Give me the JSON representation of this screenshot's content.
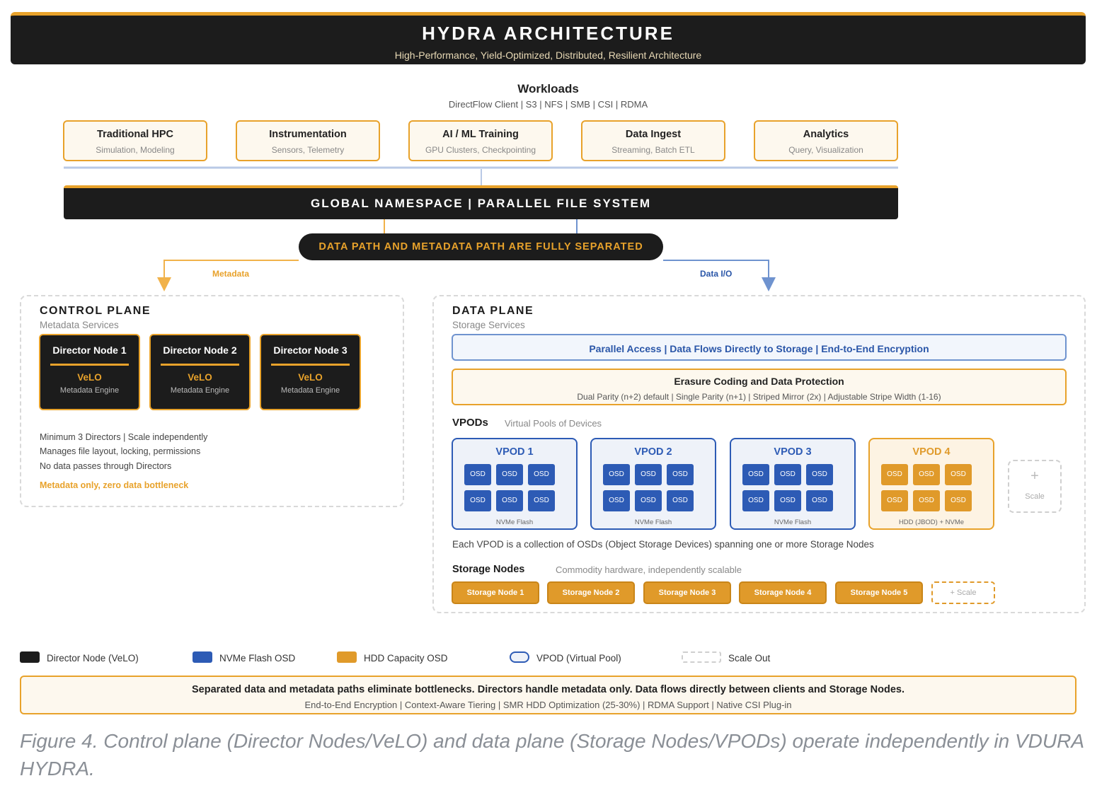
{
  "banner": {
    "title": "HYDRA ARCHITECTURE",
    "subtitle": "High-Performance, Yield-Optimized, Distributed, Resilient Architecture"
  },
  "workloads": {
    "title": "Workloads",
    "protocols": "DirectFlow Client | S3 | NFS | SMB | CSI | RDMA",
    "items": [
      {
        "name": "Traditional HPC",
        "desc": "Simulation, Modeling"
      },
      {
        "name": "Instrumentation",
        "desc": "Sensors, Telemetry"
      },
      {
        "name": "AI / ML Training",
        "desc": "GPU Clusters, Checkpointing"
      },
      {
        "name": "Data Ingest",
        "desc": "Streaming, Batch ETL"
      },
      {
        "name": "Analytics",
        "desc": "Query, Visualization"
      }
    ]
  },
  "global_namespace": "GLOBAL NAMESPACE | PARALLEL FILE SYSTEM",
  "separation_banner": "DATA PATH AND METADATA PATH ARE FULLY SEPARATED",
  "paths": {
    "metadata_label": "Metadata",
    "data_label": "Data I/O"
  },
  "control_plane": {
    "title": "CONTROL PLANE",
    "subtitle": "Metadata Services",
    "directors": [
      {
        "name": "Director Node 1",
        "engine_name": "VeLO",
        "engine_desc": "Metadata Engine"
      },
      {
        "name": "Director Node 2",
        "engine_name": "VeLO",
        "engine_desc": "Metadata Engine"
      },
      {
        "name": "Director Node 3",
        "engine_name": "VeLO",
        "engine_desc": "Metadata Engine"
      }
    ],
    "notes": [
      "Minimum 3 Directors | Scale independently",
      "Manages file layout, locking, permissions",
      "No data passes through Directors"
    ],
    "highlight": "Metadata only, zero data bottleneck"
  },
  "data_plane": {
    "title": "DATA PLANE",
    "subtitle": "Storage Services",
    "parallel_access": "Parallel Access | Data Flows Directly to Storage | End-to-End Encryption",
    "erasure": {
      "title": "Erasure Coding and Data Protection",
      "desc": "Dual Parity (n+2) default | Single Parity (n+1) | Striped Mirror (2x) | Adjustable Stripe Width (1-16)"
    },
    "vpods_title": "VPODs",
    "vpods_subtitle": "Virtual Pools of Devices",
    "osd_label": "OSD",
    "vpods": [
      {
        "name": "VPOD 1",
        "media": "NVMe Flash"
      },
      {
        "name": "VPOD 2",
        "media": "NVMe Flash"
      },
      {
        "name": "VPOD 3",
        "media": "NVMe Flash"
      },
      {
        "name": "VPOD 4",
        "media": "HDD (JBOD) + NVMe"
      }
    ],
    "vpod_scale": {
      "plus": "+",
      "label": "Scale"
    },
    "vpod_note": "Each VPOD is a collection of OSDs (Object Storage Devices) spanning one or more Storage Nodes",
    "storage_nodes_title": "Storage Nodes",
    "storage_nodes_subtitle": "Commodity hardware, independently scalable",
    "storage_nodes": [
      "Storage Node 1",
      "Storage Node 2",
      "Storage Node 3",
      "Storage Node 4",
      "Storage Node 5"
    ],
    "storage_scale": "+ Scale"
  },
  "legend": [
    {
      "label": "Director Node (VeLO)",
      "color": "#1c1c1c"
    },
    {
      "label": "NVMe Flash OSD",
      "color": "#2d5bb5"
    },
    {
      "label": "HDD Capacity OSD",
      "color": "#e09a2a"
    },
    {
      "label": "VPOD (Virtual Pool)",
      "color": "#eef2f9"
    },
    {
      "label": "Scale Out",
      "color": "#ffffff"
    }
  ],
  "summary": {
    "title": "Separated data and metadata paths eliminate bottlenecks. Directors handle metadata only. Data flows directly between clients and Storage Nodes.",
    "features": "End-to-End Encryption | Context-Aware Tiering | SMR HDD Optimization (25-30%) | RDMA Support | Native CSI Plug-in"
  },
  "caption": "Figure 4. Control plane (Director Nodes/VeLO) and data plane (Storage Nodes/VPODs) operate independently in VDURA HYDRA.",
  "colors": {
    "accent_orange": "#e8a22b",
    "dark": "#1c1c1c",
    "blue": "#2d5bb5",
    "blue_text": "#2a56a8",
    "connector_blue": "#6f93cf"
  }
}
